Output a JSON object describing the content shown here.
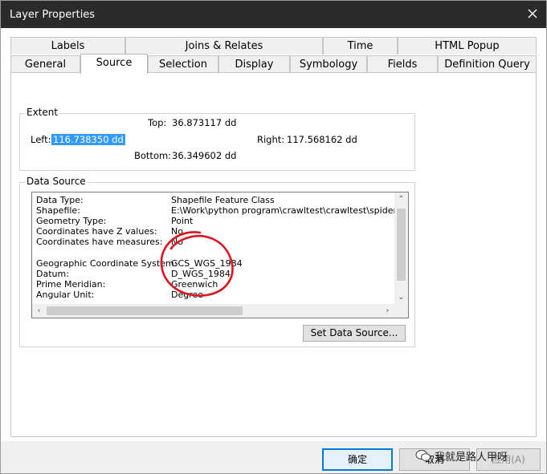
{
  "window": {
    "title": "Layer Properties"
  },
  "tabs_row1": [
    "Labels",
    "Joins & Relates",
    "Time",
    "HTML Popup"
  ],
  "tabs_row2": [
    "General",
    "Source",
    "Selection",
    "Display",
    "Symbology",
    "Fields",
    "Definition Query"
  ],
  "extent": {
    "label": "Extent",
    "top_label": "Top:",
    "top_value": "36.873117 dd",
    "left_label": "Left:",
    "left_value": "116.738350 dd",
    "right_label": "Right:",
    "right_value": "117.568162 dd",
    "bottom_label": "Bottom:",
    "bottom_value": "36.349602 dd"
  },
  "data_source": {
    "label": "Data Source",
    "rows": [
      {
        "key": "Data Type:",
        "value": "Shapefile Feature Class"
      },
      {
        "key": "Shapefile:",
        "value": "E:\\Work\\python program\\crawltest\\crawltest\\spiders\\之"
      },
      {
        "key": "Geometry Type:",
        "value": "Point"
      },
      {
        "key": "Coordinates have Z values:",
        "value": "No"
      },
      {
        "key": "Coordinates have measures:",
        "value": "No"
      },
      {
        "key": "",
        "value": ""
      },
      {
        "key": "Geographic Coordinate System:",
        "value": "GCS_WGS_1984"
      },
      {
        "key": "Datum:",
        "value": "D_WGS_1984"
      },
      {
        "key": "Prime Meridian:",
        "value": "Greenwich"
      },
      {
        "key": "Angular Unit:",
        "value": "Degree"
      }
    ],
    "set_button": "Set Data Source..."
  },
  "buttons": {
    "ok": "确定",
    "cancel": "取消",
    "apply": "应用(A)"
  },
  "watermark": "我就是路人甲呀"
}
